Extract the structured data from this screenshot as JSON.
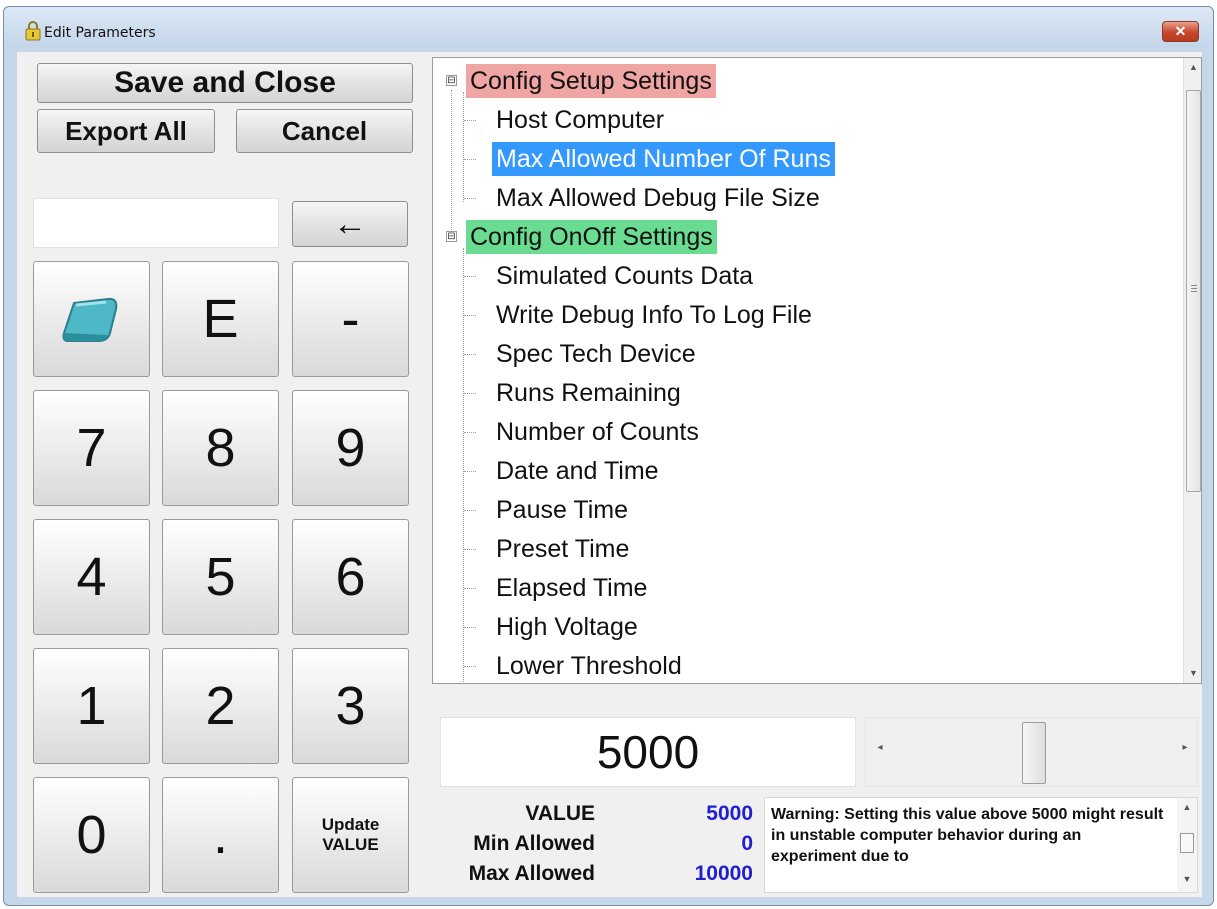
{
  "window": {
    "title": "Edit Parameters",
    "close_label": "✕"
  },
  "commands": {
    "save_close": "Save and Close",
    "export_all": "Export All",
    "cancel": "Cancel",
    "backspace": "←"
  },
  "entry": {
    "value": ""
  },
  "keypad": {
    "eraser_icon": "eraser-icon",
    "keys": [
      "E",
      "-",
      "7",
      "8",
      "9",
      "4",
      "5",
      "6",
      "1",
      "2",
      "3",
      "0",
      "."
    ],
    "update_line1": "Update",
    "update_line2": "VALUE"
  },
  "tree": {
    "categories": [
      {
        "label": "Config Setup Settings",
        "color": "#f0a5a5",
        "expanded_symbol": "⊟",
        "items": [
          "Host Computer",
          "Max Allowed Number Of Runs",
          "Max Allowed Debug File Size"
        ]
      },
      {
        "label": "Config OnOff Settings",
        "color": "#69dc91",
        "expanded_symbol": "⊟",
        "items": [
          "Simulated Counts Data",
          "Write Debug Info To Log File",
          "Spec Tech Device",
          "Runs Remaining",
          "Number of Counts",
          "Date and Time",
          "Pause Time",
          "Preset Time",
          "Elapsed Time",
          "High Voltage",
          "Lower Threshold"
        ]
      }
    ],
    "selected_item": "Max Allowed Number Of Runs",
    "selection_color": "#3399ff"
  },
  "value_panel": {
    "display": "5000",
    "slider_position_fraction": 0.5,
    "value_label": "VALUE",
    "value": "5000",
    "min_label": "Min Allowed",
    "min": "0",
    "max_label": "Max Allowed",
    "max": "10000",
    "warning_text": "Warning: Setting this value above 5000 might result in unstable computer behavior during an experiment due to"
  }
}
